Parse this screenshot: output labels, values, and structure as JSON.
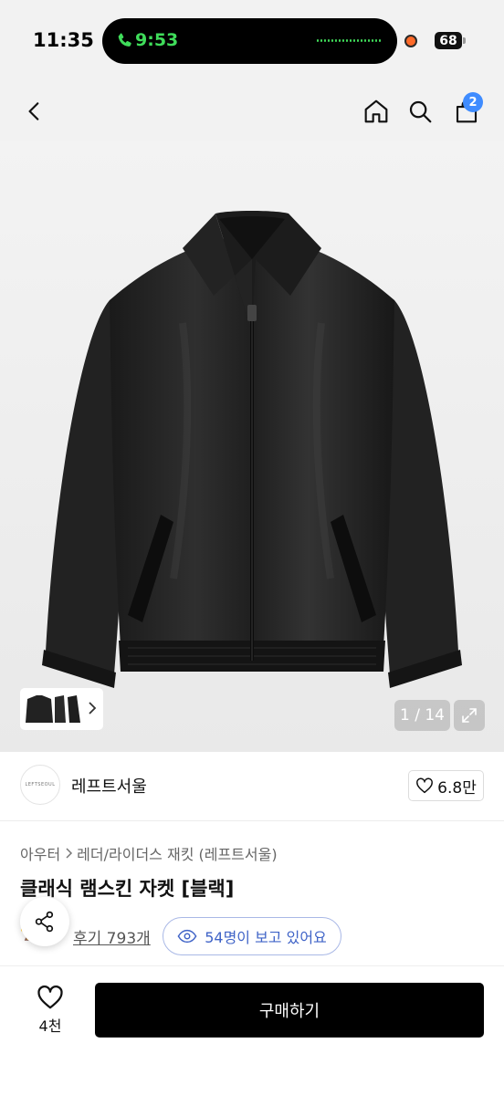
{
  "status_bar": {
    "time": "11:35",
    "call_time": "9:53",
    "battery": "68"
  },
  "nav": {
    "cart_badge": "2"
  },
  "gallery": {
    "page_indicator": "1 / 14"
  },
  "brand": {
    "logo_text": "LEFTSEOUL",
    "name": "레프트서울",
    "likes": "6.8만"
  },
  "breadcrumb": {
    "level1": "아우터",
    "level2": "레더/라이더스 재킷 (레프트서울)"
  },
  "product": {
    "title": "클래식 램스킨 자켓 [블랙]",
    "review_link": "후기 793개",
    "viewers": "54명이 보고 있어요"
  },
  "bottom_bar": {
    "wish_count": "4천",
    "buy_label": "구매하기"
  },
  "colors": {
    "accent_blue": "#3f8cff",
    "viewer_blue": "#3f63c7",
    "call_green": "#3fdc5a",
    "buy_button": "#000000"
  },
  "icons": [
    "back-icon",
    "home-icon",
    "search-icon",
    "cart-icon",
    "chevron-right-icon",
    "expand-icon",
    "heart-icon",
    "share-icon",
    "eye-icon",
    "phone-icon"
  ]
}
